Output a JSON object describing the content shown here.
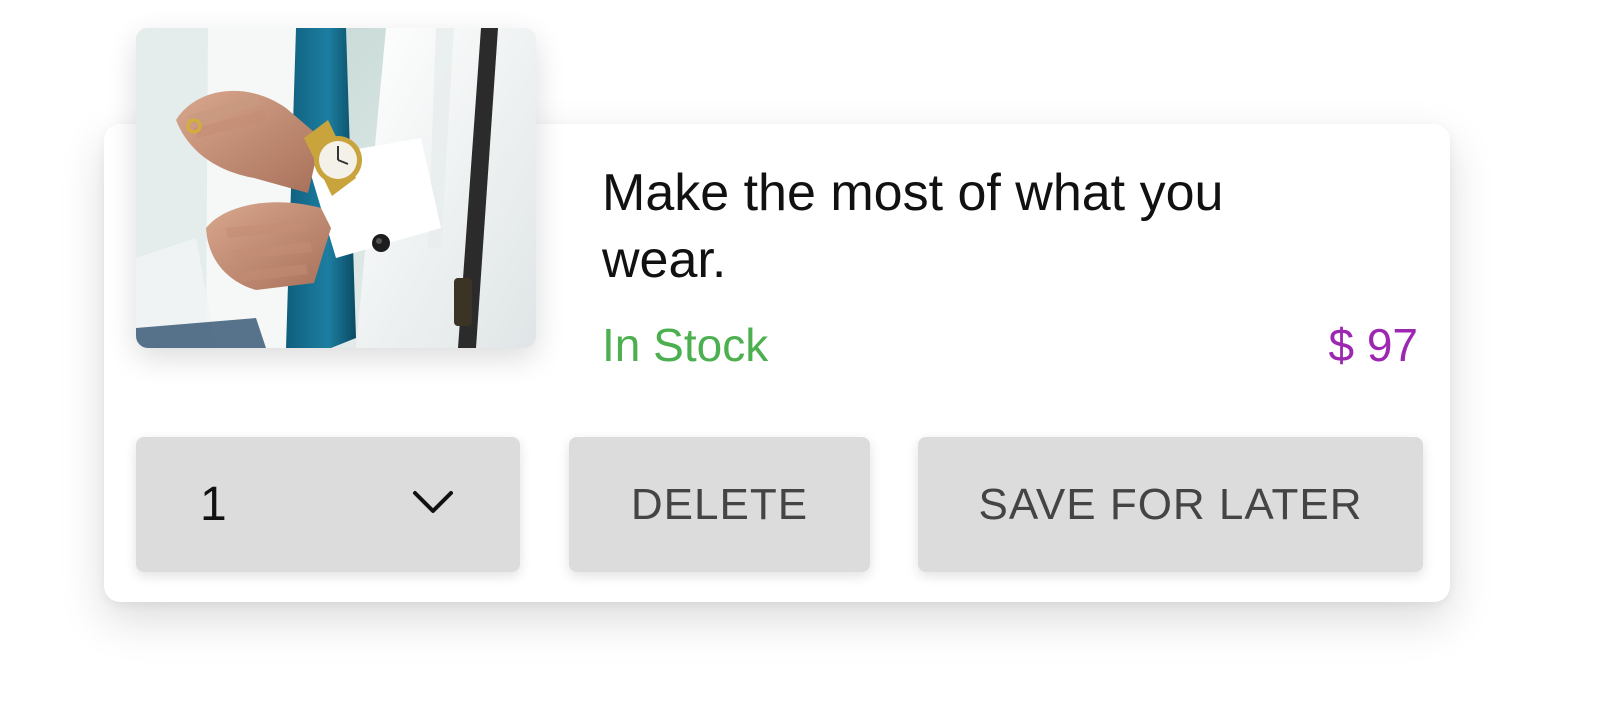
{
  "product": {
    "title": "Make the most of what you wear.",
    "stock_status": "In Stock",
    "price": "$ 97",
    "image": "man-adjusting-cufflink-wearing-gold-watch"
  },
  "actions": {
    "quantity": "1",
    "delete_label": "DELETE",
    "save_label": "SAVE FOR LATER"
  },
  "colors": {
    "stock": "#4caf50",
    "price": "#9c27b0",
    "button_bg": "#dcdcdc"
  }
}
